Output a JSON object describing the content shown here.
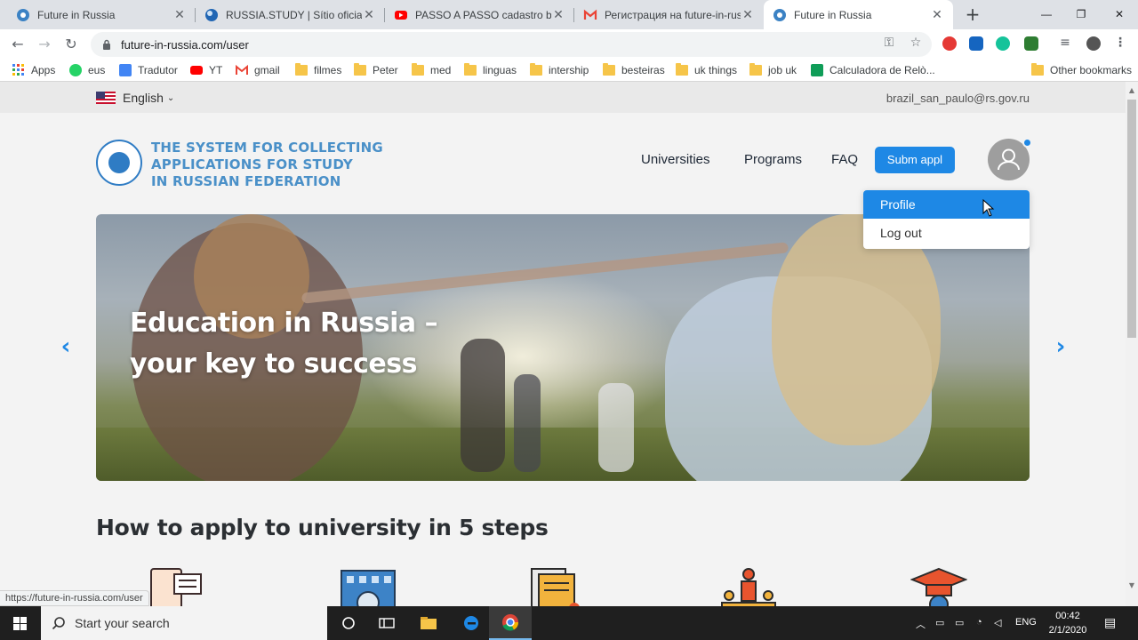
{
  "browser": {
    "tabs": [
      {
        "title": "Future in Russia",
        "icon": "globe-icon",
        "active": false
      },
      {
        "title": "RUSSIA.STUDY | Sítio oficial de",
        "icon": "globe-icon",
        "active": false
      },
      {
        "title": "PASSO A PASSO cadastro bols",
        "icon": "youtube-icon",
        "active": false
      },
      {
        "title": "Регистрация на future-in-russ",
        "icon": "gmail-icon",
        "active": false
      },
      {
        "title": "Future in Russia",
        "icon": "globe-icon",
        "active": true
      }
    ],
    "url": "future-in-russia.com/user",
    "bookmarks": [
      {
        "label": "Apps",
        "icon": "apps-grid-icon"
      },
      {
        "label": "eus",
        "icon": "whatsapp-icon"
      },
      {
        "label": "Tradutor",
        "icon": "translate-icon"
      },
      {
        "label": "YT",
        "icon": "youtube-icon"
      },
      {
        "label": "gmail",
        "icon": "gmail-icon"
      },
      {
        "label": "filmes",
        "icon": "folder-icon"
      },
      {
        "label": "Peter",
        "icon": "folder-icon"
      },
      {
        "label": "med",
        "icon": "folder-icon"
      },
      {
        "label": "linguas",
        "icon": "folder-icon"
      },
      {
        "label": "intership",
        "icon": "folder-icon"
      },
      {
        "label": "besteiras",
        "icon": "folder-icon"
      },
      {
        "label": "uk things",
        "icon": "folder-icon"
      },
      {
        "label": "job uk",
        "icon": "folder-icon"
      },
      {
        "label": "Calculadora de Relò...",
        "icon": "sheets-icon"
      }
    ],
    "other_bookmarks": "Other bookmarks",
    "status_url": "https://future-in-russia.com/user"
  },
  "site": {
    "language": "English",
    "email": "brazil_san_paulo@rs.gov.ru",
    "logo_lines": [
      "THE SYSTEM FOR COLLECTING",
      "APPLICATIONS FOR STUDY",
      "IN RUSSIAN FEDERATION"
    ],
    "nav": {
      "universities": "Universities",
      "programs": "Programs",
      "faq": "FAQ",
      "submit": "Subm appl"
    },
    "user_menu": {
      "profile": "Profile",
      "logout": "Log out"
    },
    "hero": {
      "line1": "Education in Russia –",
      "line2": "your key to success"
    },
    "steps_title": "How to apply to university in 5 steps"
  },
  "taskbar": {
    "search_placeholder": "Start your search",
    "lang": "ENG",
    "time": "00:42",
    "date": "2/1/2020"
  },
  "colors": {
    "brand_blue": "#1e88e5",
    "logo_blue": "#4a90c8"
  }
}
